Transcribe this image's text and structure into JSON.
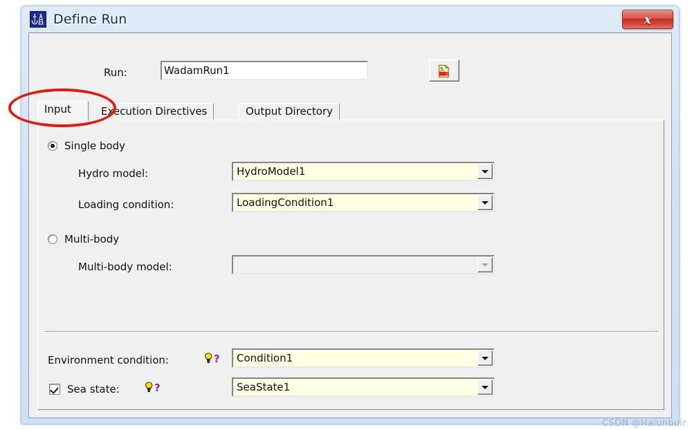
{
  "window": {
    "title": "Define Run",
    "app_icon": "ship-anchor-icon",
    "close_label": "x"
  },
  "run_row": {
    "label": "Run:",
    "value": "WadamRun1",
    "placeholder": "",
    "icon_button": "export-document-icon"
  },
  "tabs": [
    {
      "label": "Input",
      "selected": true
    },
    {
      "label": "Execution Directives",
      "selected": false
    },
    {
      "label": "Output Directory",
      "selected": false
    }
  ],
  "input_tab": {
    "single_body": {
      "label": "Single body",
      "checked": true
    },
    "hydro_model": {
      "label": "Hydro model:",
      "value": "HydroModel1",
      "enabled": true
    },
    "loading_condition": {
      "label": "Loading condition:",
      "value": "LoadingCondition1",
      "enabled": true
    },
    "multi_body": {
      "label": "Multi-body",
      "checked": false
    },
    "multi_body_model": {
      "label": "Multi-body model:",
      "value": "",
      "enabled": false
    },
    "environment_condition": {
      "label": "Environment condition:",
      "value": "Condition1",
      "hint_icon": "lightbulb-help-icon"
    },
    "sea_state": {
      "label": "Sea state:",
      "value": "SeaState1",
      "checked": true,
      "hint_icon": "lightbulb-help-icon"
    }
  },
  "annotation": {
    "shape": "red-ellipse",
    "target": "Input"
  },
  "watermark": {
    "text": "CSDN @Haiunbuir"
  },
  "colors": {
    "title_bar": "#d3e3f5",
    "dialog_face": "#f0f0f0",
    "combo_field": "#ffffe4",
    "annotation_red": "#e01b10",
    "close_red": "#bf2e22",
    "hint_yellow": "#ffe000",
    "hint_purple": "#9b1f9b"
  }
}
